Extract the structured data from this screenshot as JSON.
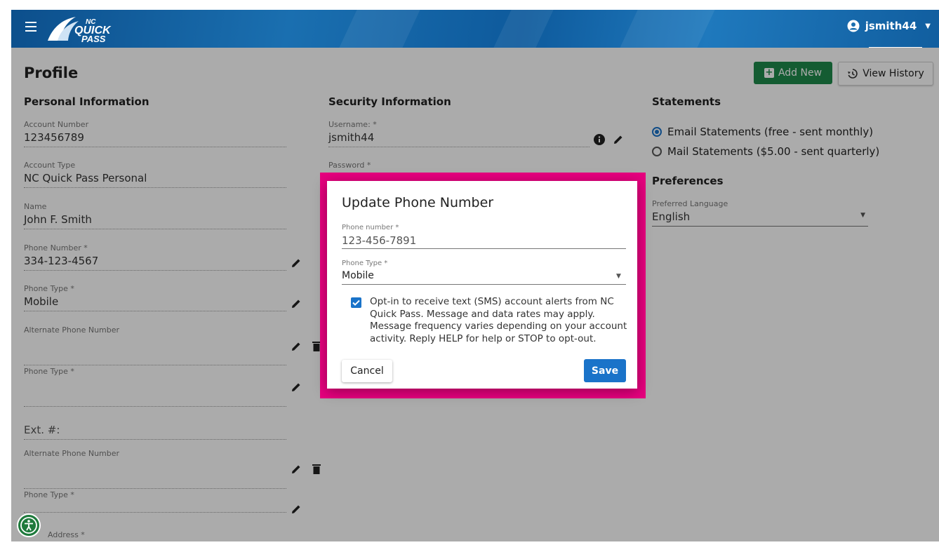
{
  "header": {
    "username": "jsmith44"
  },
  "page": {
    "title": "Profile",
    "add_new": "Add New",
    "view_history": "View History"
  },
  "personal": {
    "heading": "Personal Information",
    "fields": [
      {
        "label": "Account Number",
        "value": "123456789"
      },
      {
        "label": "Account Type",
        "value": "NC Quick Pass Personal"
      },
      {
        "label": "Name",
        "value": "John F. Smith"
      },
      {
        "label": "Phone Number *",
        "value": "334-123-4567"
      },
      {
        "label": "Phone Type *",
        "value": "Mobile"
      },
      {
        "label": "Alternate Phone Number",
        "value": ""
      },
      {
        "label": "Phone Type *",
        "value": ""
      },
      {
        "label": "",
        "value": "Ext. #:"
      },
      {
        "label": "Alternate Phone Number",
        "value": ""
      },
      {
        "label": "Phone Type *",
        "value": ""
      },
      {
        "label": "Address *",
        "value": ""
      }
    ]
  },
  "security": {
    "heading": "Security Information",
    "username_label": "Username: *",
    "username_value": "jsmith44",
    "password_label": "Password *"
  },
  "statements": {
    "heading": "Statements",
    "options": [
      {
        "label": "Email Statements (free - sent monthly)",
        "selected": true
      },
      {
        "label": "Mail Statements ($5.00 - sent quarterly)",
        "selected": false
      }
    ]
  },
  "preferences": {
    "heading": "Preferences",
    "language_label": "Preferred Language",
    "language_value": "English"
  },
  "modal": {
    "title": "Update Phone Number",
    "phone_label": "Phone number *",
    "phone_value": "123-456-7891",
    "type_label": "Phone Type *",
    "type_value": "Mobile",
    "optin_checked": true,
    "optin_text": "Opt-in to receive text (SMS) account alerts from NC Quick Pass. Message and data rates may apply. Message frequency varies depending on your account activity. Reply HELP for help or STOP to opt-out.",
    "cancel_label": "Cancel",
    "save_label": "Save"
  },
  "colors": {
    "accent": "#1a73c9",
    "add_button": "#1e8a4b",
    "highlight": "#e6007e",
    "header": "#0e5a9c"
  },
  "icons": [
    "menu-icon",
    "quick-pass-logo",
    "user-circle-icon",
    "caret-down-icon",
    "plus-icon",
    "history-icon",
    "pencil-icon",
    "trash-icon",
    "info-icon",
    "accessibility-icon"
  ]
}
